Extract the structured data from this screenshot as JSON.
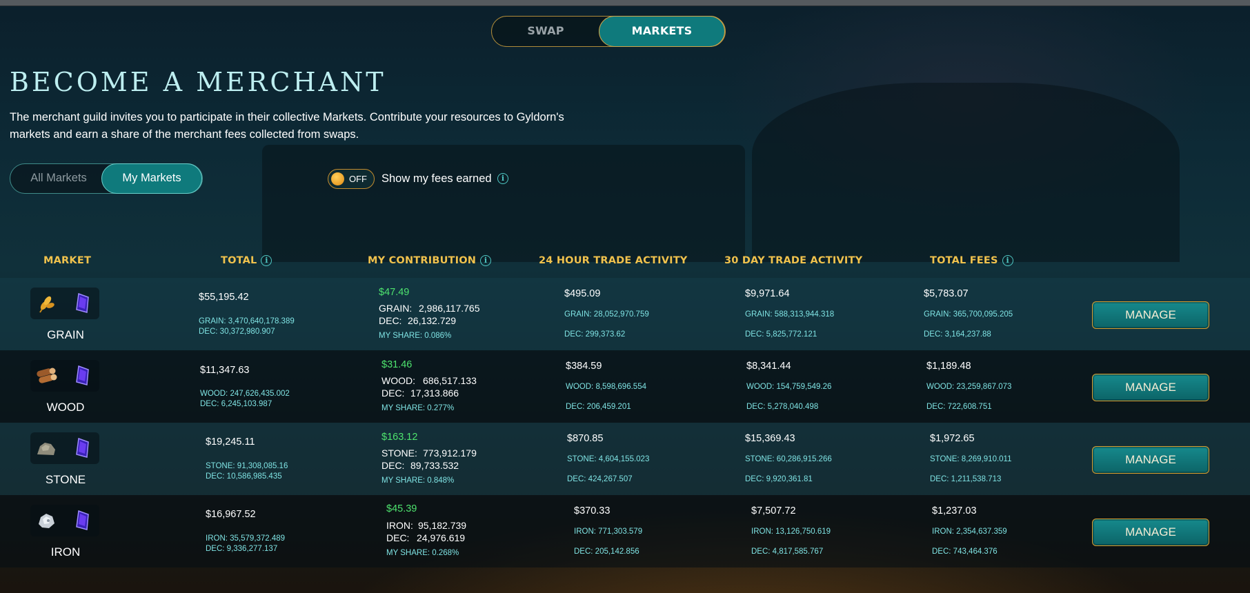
{
  "nav": {
    "swap_label": "SWAP",
    "markets_label": "MARKETS"
  },
  "page": {
    "title": "BECOME A MERCHANT",
    "description": "The merchant guild invites you to participate in their collective Markets. Contribute your resources to Gyldorn's markets and earn a share of the merchant fees collected from swaps."
  },
  "filter": {
    "all_label": "All Markets",
    "mine_label": "My Markets"
  },
  "fees_toggle": {
    "state_label": "OFF",
    "label": "Show my fees earned"
  },
  "info_glyph": "i",
  "table": {
    "headers": {
      "market": "MARKET",
      "total": "TOTAL",
      "contribution": "MY CONTRIBUTION",
      "day": "24 HOUR TRADE ACTIVITY",
      "month": "30 DAY TRADE ACTIVITY",
      "fees": "TOTAL FEES"
    },
    "manage_label": "MANAGE",
    "rows": [
      {
        "name": "GRAIN",
        "icon": "grain-icon",
        "total": "$55,195.42",
        "total_res": "GRAIN: 3,470,640,178.389",
        "total_dec": "DEC: 30,372,980.907",
        "c_usd": "$47.49",
        "c_res_k": "GRAIN:",
        "c_res_v": "2,986,117.765",
        "c_dec_k": "DEC:",
        "c_dec_v": "26,132.729",
        "c_share": "MY SHARE: 0.086%",
        "d_usd": "$495.09",
        "d_res": "GRAIN: 28,052,970.759",
        "d_dec": "DEC: 299,373.62",
        "m_usd": "$9,971.64",
        "m_res": "GRAIN: 588,313,944.318",
        "m_dec": "DEC: 5,825,772.121",
        "f_usd": "$5,783.07",
        "f_res": "GRAIN: 365,700,095.205",
        "f_dec": "DEC: 3,164,237.88"
      },
      {
        "name": "WOOD",
        "icon": "wood-icon",
        "total": "$11,347.63",
        "total_res": "WOOD: 247,626,435.002",
        "total_dec": "DEC: 6,245,103.987",
        "c_usd": "$31.46",
        "c_res_k": "WOOD:",
        "c_res_v": "686,517.133",
        "c_dec_k": "DEC:",
        "c_dec_v": "17,313.866",
        "c_share": "MY SHARE: 0.277%",
        "d_usd": "$384.59",
        "d_res": "WOOD: 8,598,696.554",
        "d_dec": "DEC: 206,459.201",
        "m_usd": "$8,341.44",
        "m_res": "WOOD: 154,759,549.26",
        "m_dec": "DEC: 5,278,040.498",
        "f_usd": "$1,189.48",
        "f_res": "WOOD: 23,259,867.073",
        "f_dec": "DEC: 722,608.751"
      },
      {
        "name": "STONE",
        "icon": "stone-icon",
        "total": "$19,245.11",
        "total_res": "STONE: 91,308,085.16",
        "total_dec": "DEC: 10,586,985.435",
        "c_usd": "$163.12",
        "c_res_k": "STONE:",
        "c_res_v": "773,912.179",
        "c_dec_k": "DEC:",
        "c_dec_v": "89,733.532",
        "c_share": "MY SHARE: 0.848%",
        "d_usd": "$870.85",
        "d_res": "STONE: 4,604,155.023",
        "d_dec": "DEC: 424,267.507",
        "m_usd": "$15,369.43",
        "m_res": "STONE: 60,286,915.266",
        "m_dec": "DEC: 9,920,361.81",
        "f_usd": "$1,972.65",
        "f_res": "STONE: 8,269,910.011",
        "f_dec": "DEC: 1,211,538.713"
      },
      {
        "name": "IRON",
        "icon": "iron-icon",
        "total": "$16,967.52",
        "total_res": "IRON: 35,579,372.489",
        "total_dec": "DEC: 9,336,277.137",
        "c_usd": "$45.39",
        "c_res_k": "IRON:",
        "c_res_v": "95,182.739",
        "c_dec_k": "DEC:",
        "c_dec_v": "24,976.619",
        "c_share": "MY SHARE: 0.268%",
        "d_usd": "$370.33",
        "d_res": "IRON: 771,303.579",
        "d_dec": "DEC: 205,142.856",
        "m_usd": "$7,507.72",
        "m_res": "IRON: 13,126,750.619",
        "m_dec": "DEC: 4,817,585.767",
        "f_usd": "$1,237.03",
        "f_res": "IRON: 2,354,637.359",
        "f_dec": "DEC: 743,464.376"
      }
    ]
  },
  "colors": {
    "accent_teal": "#0f7a7c",
    "header_gold": "#f0c24d",
    "positive_green": "#4ee36e",
    "sub_cyan": "#7fe3e3"
  }
}
